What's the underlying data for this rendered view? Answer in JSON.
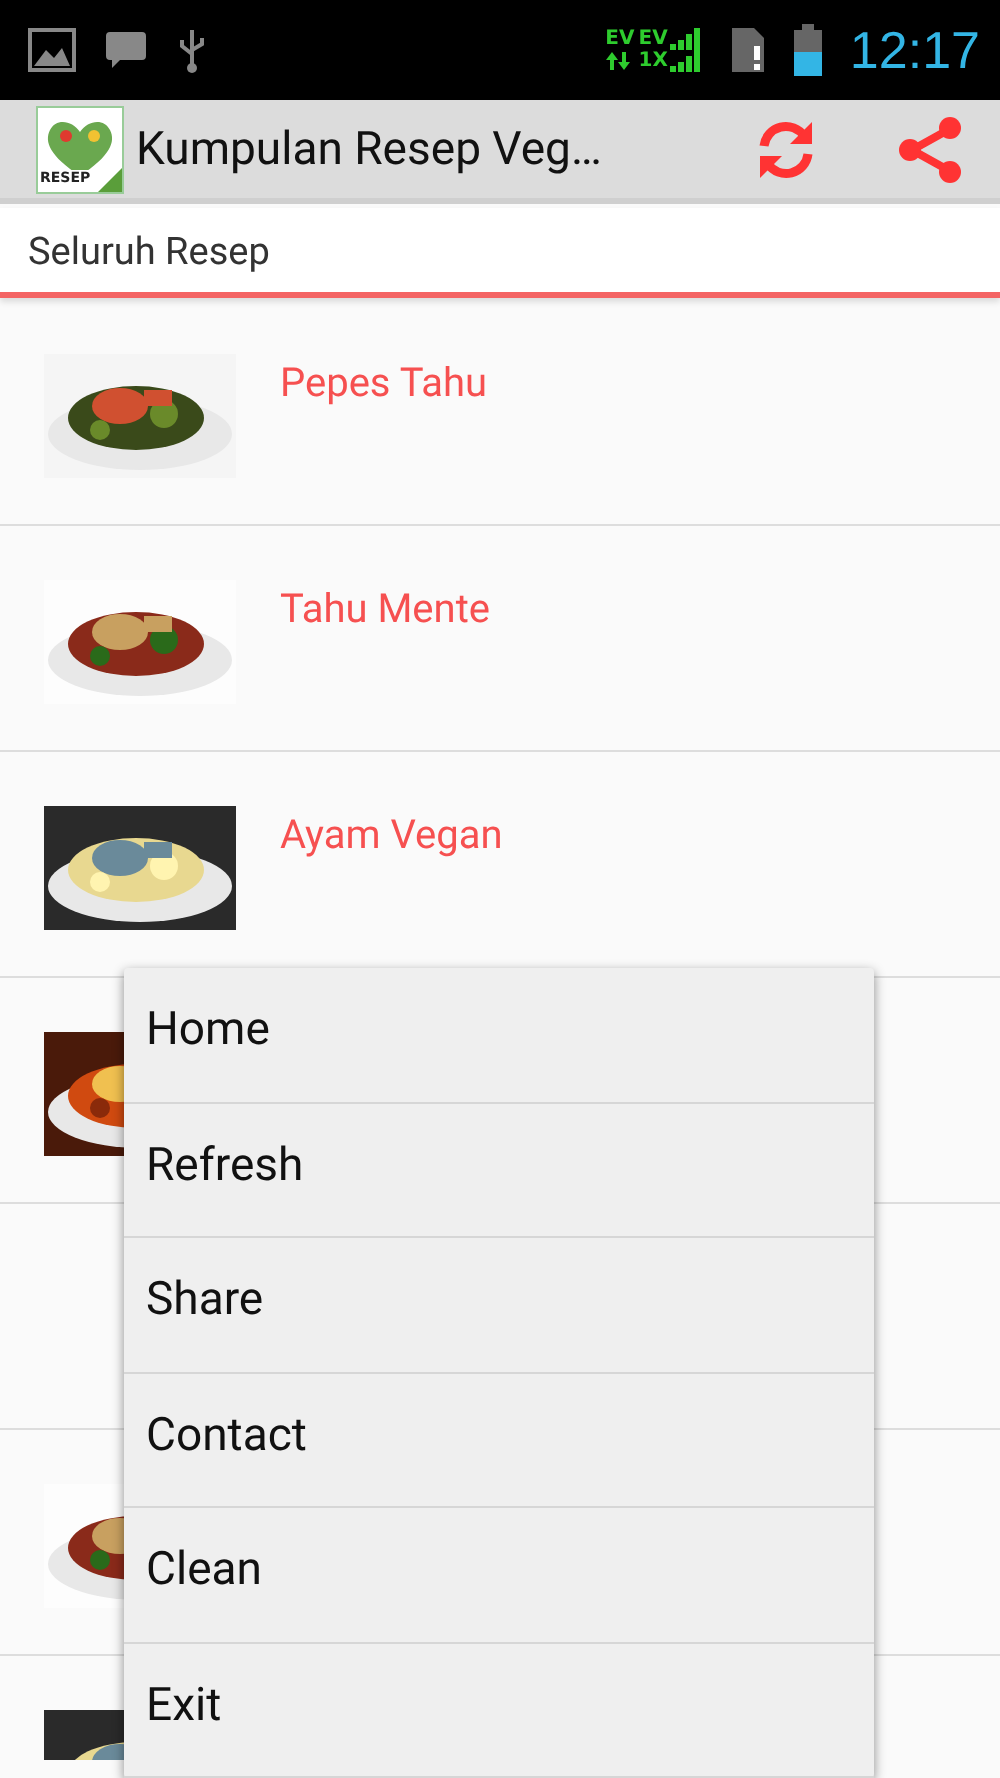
{
  "status_bar": {
    "network_top": "EV",
    "network_mid": "EV",
    "network_bottom": "1X",
    "time": "12:17"
  },
  "action_bar": {
    "logo_text": "RESEP",
    "title": "Kumpulan Resep Veg…"
  },
  "tab": {
    "label": "Seluruh Resep"
  },
  "recipes": [
    {
      "title": "Pepes Tahu",
      "image": true
    },
    {
      "title": "Tahu Mente",
      "image": true
    },
    {
      "title": "Ayam Vegan",
      "image": true
    },
    {
      "image": true
    },
    {
      "image": false
    },
    {
      "image": true
    },
    {
      "image": true
    }
  ],
  "menu": [
    {
      "label": "Home"
    },
    {
      "label": "Refresh"
    },
    {
      "label": "Share"
    },
    {
      "label": "Contact"
    },
    {
      "label": "Clean"
    },
    {
      "label": "Exit"
    }
  ]
}
